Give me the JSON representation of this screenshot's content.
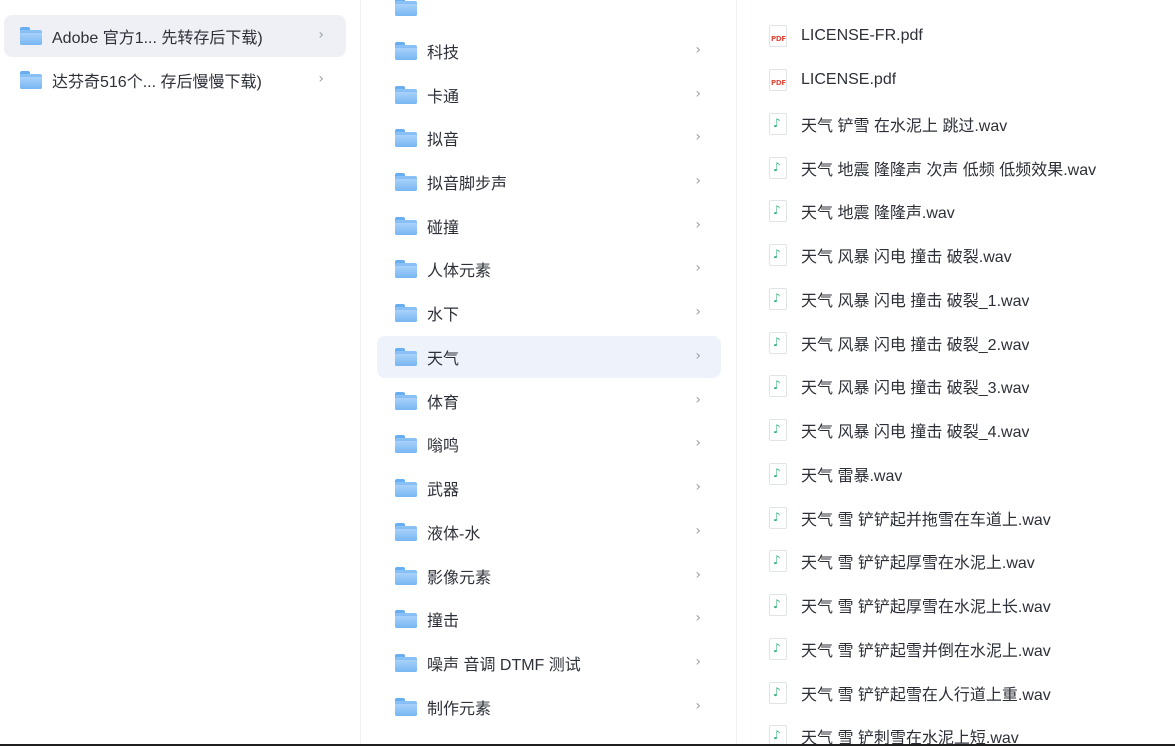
{
  "column1": {
    "items": [
      {
        "label": "Adobe 官方1...  先转存后下载)",
        "chevron": "›"
      },
      {
        "label": "达芬奇516个...  存后慢慢下载)",
        "chevron": "›"
      }
    ]
  },
  "column2": {
    "items": [
      {
        "label": "科技",
        "chevron": "›"
      },
      {
        "label": "卡通",
        "chevron": "›"
      },
      {
        "label": "拟音",
        "chevron": "›"
      },
      {
        "label": "拟音脚步声",
        "chevron": "›"
      },
      {
        "label": "碰撞",
        "chevron": "›"
      },
      {
        "label": "人体元素",
        "chevron": "›"
      },
      {
        "label": "水下",
        "chevron": "›"
      },
      {
        "label": "天气",
        "chevron": "›"
      },
      {
        "label": "体育",
        "chevron": "›"
      },
      {
        "label": "嗡鸣",
        "chevron": "›"
      },
      {
        "label": "武器",
        "chevron": "›"
      },
      {
        "label": "液体-水",
        "chevron": "›"
      },
      {
        "label": "影像元素",
        "chevron": "›"
      },
      {
        "label": "撞击",
        "chevron": "›"
      },
      {
        "label": "噪声 音调 DTMF 测试",
        "chevron": "›"
      },
      {
        "label": "制作元素",
        "chevron": "›"
      }
    ]
  },
  "column3": {
    "items": [
      {
        "label": "LICENSE-FR.pdf",
        "icon": "pdf-icon",
        "icon_text": "PDF"
      },
      {
        "label": "LICENSE.pdf",
        "icon": "pdf-icon",
        "icon_text": "PDF"
      },
      {
        "label": "天气 铲雪 在水泥上 跳过.wav",
        "icon": "audio-icon",
        "icon_text": "♪"
      },
      {
        "label": "天气 地震 隆隆声 次声 低频 低频效果.wav",
        "icon": "audio-icon",
        "icon_text": "♪"
      },
      {
        "label": "天气 地震 隆隆声.wav",
        "icon": "audio-icon",
        "icon_text": "♪"
      },
      {
        "label": "天气 风暴 闪电 撞击 破裂.wav",
        "icon": "audio-icon",
        "icon_text": "♪"
      },
      {
        "label": "天气 风暴 闪电 撞击 破裂_1.wav",
        "icon": "audio-icon",
        "icon_text": "♪"
      },
      {
        "label": "天气 风暴 闪电 撞击 破裂_2.wav",
        "icon": "audio-icon",
        "icon_text": "♪"
      },
      {
        "label": "天气 风暴 闪电 撞击 破裂_3.wav",
        "icon": "audio-icon",
        "icon_text": "♪"
      },
      {
        "label": "天气 风暴 闪电 撞击 破裂_4.wav",
        "icon": "audio-icon",
        "icon_text": "♪"
      },
      {
        "label": "天气 雷暴.wav",
        "icon": "audio-icon",
        "icon_text": "♪"
      },
      {
        "label": "天气 雪 铲铲起并拖雪在车道上.wav",
        "icon": "audio-icon",
        "icon_text": "♪"
      },
      {
        "label": "天气 雪 铲铲起厚雪在水泥上.wav",
        "icon": "audio-icon",
        "icon_text": "♪"
      },
      {
        "label": "天气 雪 铲铲起厚雪在水泥上长.wav",
        "icon": "audio-icon",
        "icon_text": "♪"
      },
      {
        "label": "天气 雪 铲铲起雪并倒在水泥上.wav",
        "icon": "audio-icon",
        "icon_text": "♪"
      },
      {
        "label": "天气 雪 铲铲起雪在人行道上重.wav",
        "icon": "audio-icon",
        "icon_text": "♪"
      },
      {
        "label": "天气 雪 铲刺雪在水泥上短.wav",
        "icon": "audio-icon",
        "icon_text": "♪"
      }
    ]
  },
  "colors": {
    "selected_row": "#eef2fb",
    "folder_blue": "#6aaef2",
    "audio_green": "#2eb27a",
    "pdf_red": "#e24c3c"
  }
}
